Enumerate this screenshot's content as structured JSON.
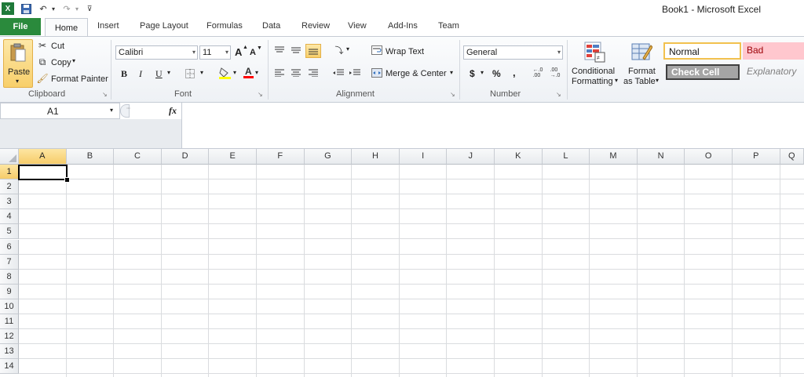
{
  "window": {
    "title": "Book1  -  Microsoft Excel"
  },
  "quick_access": {
    "save_icon": "save-icon",
    "undo_icon": "undo-icon",
    "redo_icon": "redo-icon",
    "customize_icon": "customize-qat-icon"
  },
  "tabs": [
    "File",
    "Home",
    "Insert",
    "Page Layout",
    "Formulas",
    "Data",
    "Review",
    "View",
    "Add-Ins",
    "Team"
  ],
  "active_tab": "Home",
  "ribbon": {
    "clipboard": {
      "label": "Clipboard",
      "paste": "Paste",
      "cut": "Cut",
      "copy": "Copy",
      "format_painter": "Format Painter"
    },
    "font": {
      "label": "Font",
      "font_name": "Calibri",
      "font_size": "11",
      "bold": "B",
      "italic": "I",
      "underline": "U",
      "grow": "A",
      "shrink": "A"
    },
    "alignment": {
      "label": "Alignment",
      "wrap_text": "Wrap Text",
      "merge_center": "Merge & Center"
    },
    "number": {
      "label": "Number",
      "format": "General",
      "currency": "$",
      "percent": "%",
      "comma": ","
    },
    "styles": {
      "conditional_formatting_1": "Conditional",
      "conditional_formatting_2": "Formatting",
      "format_table_1": "Format",
      "format_table_2": "as Table",
      "normal": "Normal",
      "bad": "Bad",
      "check_cell": "Check Cell",
      "explanatory": "Explanatory"
    }
  },
  "formula_bar": {
    "name_box": "A1",
    "fx": "fx",
    "value": ""
  },
  "grid": {
    "columns": [
      "A",
      "B",
      "C",
      "D",
      "E",
      "F",
      "G",
      "H",
      "I",
      "J",
      "K",
      "L",
      "M",
      "N",
      "O",
      "P",
      "Q"
    ],
    "rows": [
      "1",
      "2",
      "3",
      "4",
      "5",
      "6",
      "7",
      "8",
      "9",
      "10",
      "11",
      "12",
      "13",
      "14"
    ],
    "selected_cell": "A1"
  },
  "colors": {
    "file_tab": "#2a8a3c",
    "selection_border": "#000000",
    "header_selected": "#f6cc6a",
    "bad_fill": "#ffc7ce",
    "bad_text": "#9c0006",
    "check_cell_fill": "#a5a5a5"
  }
}
